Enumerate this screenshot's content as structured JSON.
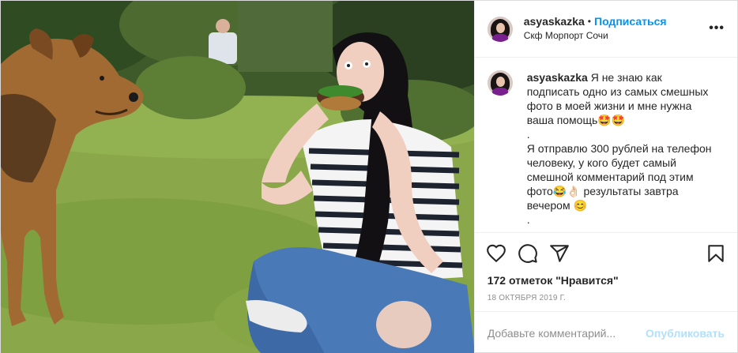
{
  "post": {
    "username": "asyaskazka",
    "separator": "•",
    "follow_label": "Подписаться",
    "location": "Скф Морпорт Сочи",
    "more_label": "•••",
    "caption_username": "asyaskazka",
    "caption_text": "Я не знаю как подписать одно из самых смешных фото в моей жизни и мне нужна ваша помощь🤩🤩\n.\nЯ отправлю 300 рублей на телефон человеку, у кого будет самый смешной комментарий под этим фото😂👌🏻 результаты завтра вечером 😊\n.",
    "likes": "172 отметок \"Нравится\"",
    "date": "18 ОКТЯБРЯ 2019 Г.",
    "comment_placeholder": "Добавьте комментарий...",
    "publish_label": "Опубликовать"
  },
  "icons": {
    "like": "heart-icon",
    "comment": "comment-icon",
    "share": "paper-plane-icon",
    "save": "bookmark-icon",
    "more": "more-options-icon"
  },
  "colors": {
    "link_blue": "#0095f6",
    "publish_disabled": "#b2dffc",
    "muted_gray": "#8e8e8e",
    "border": "#efefef"
  }
}
